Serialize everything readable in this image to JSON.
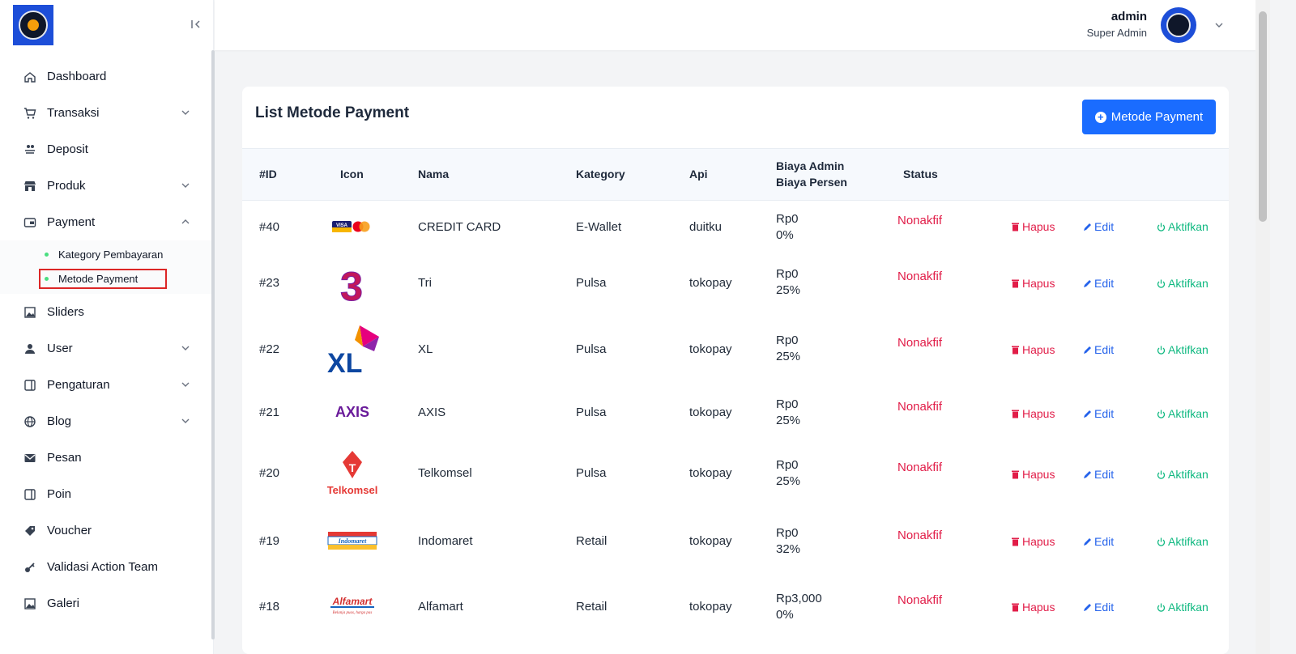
{
  "sidebar": {
    "items": [
      {
        "label": "Dashboard",
        "icon": "home-icon"
      },
      {
        "label": "Transaksi",
        "icon": "cart-icon",
        "has_chevron": true
      },
      {
        "label": "Deposit",
        "icon": "deposit-icon"
      },
      {
        "label": "Produk",
        "icon": "store-icon",
        "has_chevron": true
      },
      {
        "label": "Payment",
        "icon": "wallet-icon",
        "has_chevron": true,
        "expanded": true,
        "children": [
          "Kategory Pembayaran",
          "Metode Payment"
        ]
      },
      {
        "label": "Sliders",
        "icon": "image-icon"
      },
      {
        "label": "User",
        "icon": "user-icon",
        "has_chevron": true
      },
      {
        "label": "Pengaturan",
        "icon": "settings-panel-icon",
        "has_chevron": true
      },
      {
        "label": "Blog",
        "icon": "globe-icon",
        "has_chevron": true
      },
      {
        "label": "Pesan",
        "icon": "mail-icon"
      },
      {
        "label": "Poin",
        "icon": "panel-icon"
      },
      {
        "label": "Voucher",
        "icon": "tag-icon"
      },
      {
        "label": "Validasi Action Team",
        "icon": "key-icon"
      },
      {
        "label": "Galeri",
        "icon": "image-icon"
      }
    ],
    "active_child": "Metode Payment"
  },
  "header": {
    "user_name": "admin",
    "user_role": "Super Admin"
  },
  "main": {
    "title": "List Metode Payment",
    "add_button": "Metode Payment",
    "columns": {
      "id": "#ID",
      "icon": "Icon",
      "nama": "Nama",
      "kategory": "Kategory",
      "api": "Api",
      "biaya_admin": "Biaya Admin",
      "biaya_persen": "Biaya Persen",
      "status": "Status"
    },
    "actions": {
      "hapus": "Hapus",
      "edit": "Edit",
      "aktifkan": "Aktifkan"
    },
    "rows": [
      {
        "id": "#40",
        "logo": "creditcard",
        "nama": "CREDIT CARD",
        "kategory": "E-Wallet",
        "api": "duitku",
        "biaya_admin": "Rp0",
        "biaya_persen": "0%",
        "status": "Nonakfif"
      },
      {
        "id": "#23",
        "logo": "tri",
        "nama": "Tri",
        "kategory": "Pulsa",
        "api": "tokopay",
        "biaya_admin": "Rp0",
        "biaya_persen": "25%",
        "status": "Nonakfif"
      },
      {
        "id": "#22",
        "logo": "xl",
        "nama": "XL",
        "kategory": "Pulsa",
        "api": "tokopay",
        "biaya_admin": "Rp0",
        "biaya_persen": "25%",
        "status": "Nonakfif"
      },
      {
        "id": "#21",
        "logo": "axis",
        "nama": "AXIS",
        "kategory": "Pulsa",
        "api": "tokopay",
        "biaya_admin": "Rp0",
        "biaya_persen": "25%",
        "status": "Nonakfif"
      },
      {
        "id": "#20",
        "logo": "telkomsel",
        "nama": "Telkomsel",
        "kategory": "Pulsa",
        "api": "tokopay",
        "biaya_admin": "Rp0",
        "biaya_persen": "25%",
        "status": "Nonakfif"
      },
      {
        "id": "#19",
        "logo": "indomaret",
        "nama": "Indomaret",
        "kategory": "Retail",
        "api": "tokopay",
        "biaya_admin": "Rp0",
        "biaya_persen": "32%",
        "status": "Nonakfif"
      },
      {
        "id": "#18",
        "logo": "alfamart",
        "nama": "Alfamart",
        "kategory": "Retail",
        "api": "tokopay",
        "biaya_admin": "Rp3,000",
        "biaya_persen": "0%",
        "status": "Nonakfif"
      }
    ]
  },
  "logos": {
    "visa": "VISA",
    "tri": "3",
    "xl": "XL",
    "axis": "AXIS",
    "telkomsel": "Telkomsel",
    "indomaret": "Indomaret",
    "alfamart": "Alfamart",
    "alfamart_tagline": "Belanja puas, harga pas"
  },
  "colors": {
    "primary": "#1a6cff",
    "danger": "#e11d48",
    "success": "#10b981",
    "link": "#2563eb"
  }
}
